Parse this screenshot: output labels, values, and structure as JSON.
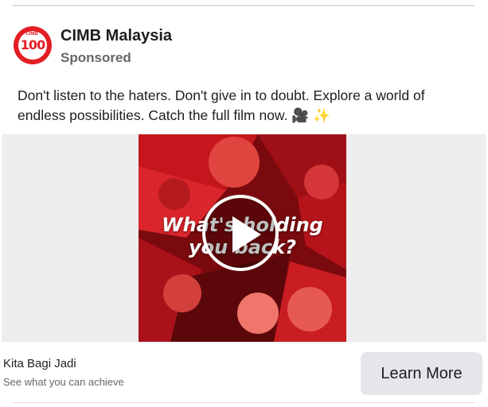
{
  "post": {
    "page_name": "CIMB Malaysia",
    "sponsored_label": "Sponsored",
    "caption_text": "Don't listen to the haters. Don't give in to doubt. Explore a world of endless possibilities. Catch the full film now. 🎥 ✨",
    "avatar": {
      "brand": "CIMB",
      "number": "100"
    }
  },
  "media": {
    "overlay_line1": "What's holding",
    "overlay_line2": "you back?",
    "play_icon": "play-icon",
    "accent_color": "#e31e24"
  },
  "footer": {
    "headline": "Kita Bagi Jadi",
    "description": "See what you can achieve",
    "cta_label": "Learn More"
  }
}
